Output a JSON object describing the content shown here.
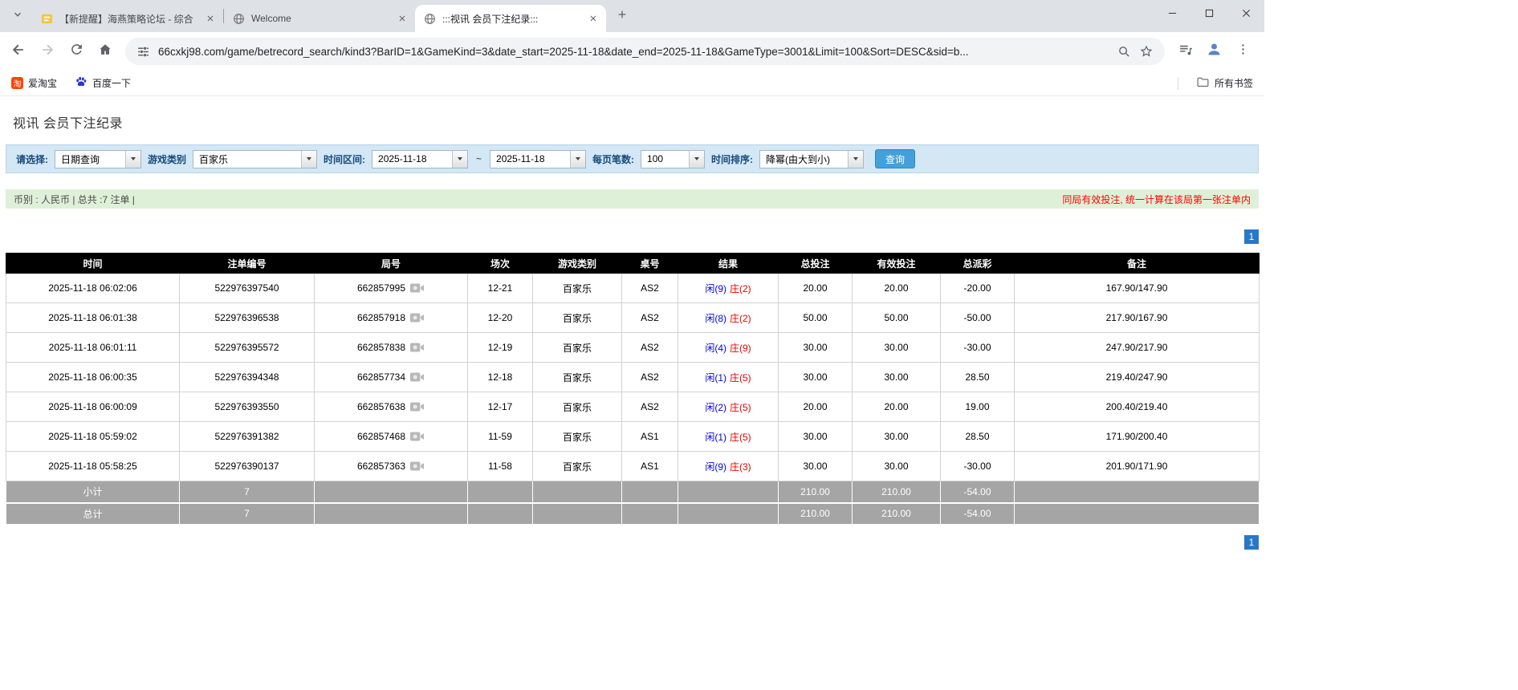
{
  "colors": {
    "accent_blue": "#43a0d8",
    "player_blue": "#0000e6",
    "banker_red": "#e60000",
    "bet_link_blue": "#0066cc",
    "negative_red": "#ff0000",
    "table_header_bg": "#000000",
    "footer_row_bg": "#a5a5a5",
    "filter_bar_bg": "#d4e7f5",
    "summary_bar_bg": "#dff0d8",
    "pagination_blue": "#2878c8"
  },
  "browser": {
    "tabs": [
      {
        "title": "【新提醒】海燕策略论坛 - 综合",
        "active": false
      },
      {
        "title": "Welcome",
        "active": false
      },
      {
        "title": ":::视讯 会员下注纪录:::",
        "active": true
      }
    ],
    "url": "66cxkj98.com/game/betrecord_search/kind3?BarID=1&GameKind=3&date_start=2025-11-18&date_end=2025-11-18&GameType=3001&Limit=100&Sort=DESC&sid=b...",
    "bookmarks": [
      {
        "label": "爱淘宝",
        "icon_text": "淘"
      },
      {
        "label": "百度一下"
      }
    ],
    "all_bookmarks": "所有书签"
  },
  "page": {
    "title": "视讯 会员下注纪录",
    "filters": {
      "select_label": "请选择:",
      "select_value": "日期查询",
      "game_label": "游戏类别",
      "game_value": "百家乐",
      "range_label": "时间区间:",
      "date_start": "2025-11-18",
      "tilde": "~",
      "date_end": "2025-11-18",
      "perpage_label": "每页笔数:",
      "perpage_value": "100",
      "sort_label": "时间排序:",
      "sort_value": "降幂(由大到小)",
      "search_button": "查询"
    },
    "summary": {
      "left": "币别 : 人民币 | 总共 :7 注单 |",
      "notice": "同局有效投注, 统一计算在该局第一张注单内"
    },
    "pagination": {
      "page": "1"
    },
    "table": {
      "headers": [
        "时间",
        "注单编号",
        "局号",
        "场次",
        "游戏类别",
        "桌号",
        "结果",
        "总投注",
        "有效投注",
        "总派彩",
        "备注"
      ],
      "rows": [
        {
          "time": "2025-11-18 06:02:06",
          "bet_id": "522976397540",
          "round": "662857995",
          "session": "12-21",
          "game": "百家乐",
          "table_no": "AS2",
          "player": "闲(9)",
          "banker": "庄(2)",
          "total_bet": "20.00",
          "valid_bet": "20.00",
          "payout": "-20.00",
          "remark": "167.90/147.90"
        },
        {
          "time": "2025-11-18 06:01:38",
          "bet_id": "522976396538",
          "round": "662857918",
          "session": "12-20",
          "game": "百家乐",
          "table_no": "AS2",
          "player": "闲(8)",
          "banker": "庄(2)",
          "total_bet": "50.00",
          "valid_bet": "50.00",
          "payout": "-50.00",
          "remark": "217.90/167.90"
        },
        {
          "time": "2025-11-18 06:01:11",
          "bet_id": "522976395572",
          "round": "662857838",
          "session": "12-19",
          "game": "百家乐",
          "table_no": "AS2",
          "player": "闲(4)",
          "banker": "庄(9)",
          "total_bet": "30.00",
          "valid_bet": "30.00",
          "payout": "-30.00",
          "remark": "247.90/217.90"
        },
        {
          "time": "2025-11-18 06:00:35",
          "bet_id": "522976394348",
          "round": "662857734",
          "session": "12-18",
          "game": "百家乐",
          "table_no": "AS2",
          "player": "闲(1)",
          "banker": "庄(5)",
          "total_bet": "30.00",
          "valid_bet": "30.00",
          "payout": "28.50",
          "remark": "219.40/247.90"
        },
        {
          "time": "2025-11-18 06:00:09",
          "bet_id": "522976393550",
          "round": "662857638",
          "session": "12-17",
          "game": "百家乐",
          "table_no": "AS2",
          "player": "闲(2)",
          "banker": "庄(5)",
          "total_bet": "20.00",
          "valid_bet": "20.00",
          "payout": "19.00",
          "remark": "200.40/219.40"
        },
        {
          "time": "2025-11-18 05:59:02",
          "bet_id": "522976391382",
          "round": "662857468",
          "session": "11-59",
          "game": "百家乐",
          "table_no": "AS1",
          "player": "闲(1)",
          "banker": "庄(5)",
          "total_bet": "30.00",
          "valid_bet": "30.00",
          "payout": "28.50",
          "remark": "171.90/200.40"
        },
        {
          "time": "2025-11-18 05:58:25",
          "bet_id": "522976390137",
          "round": "662857363",
          "session": "11-58",
          "game": "百家乐",
          "table_no": "AS1",
          "player": "闲(9)",
          "banker": "庄(3)",
          "total_bet": "30.00",
          "valid_bet": "30.00",
          "payout": "-30.00",
          "remark": "201.90/171.90"
        }
      ],
      "subtotal": {
        "label": "小计",
        "count": "7",
        "total_bet": "210.00",
        "valid_bet": "210.00",
        "payout": "-54.00"
      },
      "total": {
        "label": "总计",
        "count": "7",
        "total_bet": "210.00",
        "valid_bet": "210.00",
        "payout": "-54.00"
      }
    }
  }
}
